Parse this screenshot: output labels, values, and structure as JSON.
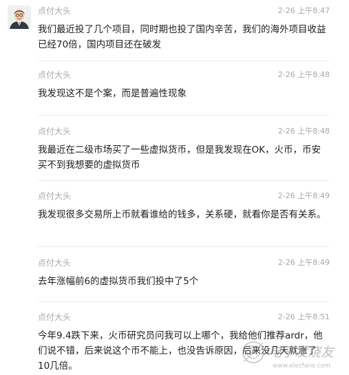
{
  "messages": [
    {
      "sender": "点付大头",
      "time": "2-26 上午8:47",
      "text": "我们最近投了几个项目，同时期也投了国内辛苦，我们的海外项目收益已经70倍，国内项目还在破发"
    },
    {
      "sender": "点付大头",
      "time": "2-26 上午8:48",
      "text": "我发现这不是个案，而是普遍性现象"
    },
    {
      "sender": "点付大头",
      "time": "2-26 上午8:48",
      "text": "我最近在二级市场买了一些虚拟货币，但是我发现在OK，火币，币安买不到我想要的虚拟货币"
    },
    {
      "sender": "点付大头",
      "time": "2-26 上午8:49",
      "text": "我发现很多交易所上币就看谁给的钱多，关系硬，就看你是否有关系。"
    },
    {
      "sender": "点付大头",
      "time": "2-26 上午8:49",
      "text": "去年涨幅前6的虚拟货币我们投中了5个"
    },
    {
      "sender": "点付大头",
      "time": "2-26 上午8:51",
      "text": "今年9.4跌下来，火币研究员问我可以上哪个，我给他们推荐ardr，他们说不错，后来说这个币不能上，也没告诉原因，后来没几天就涨了10几倍。"
    }
  ],
  "watermark": {
    "text": "电子发烧友",
    "url": "www.elecfans.com"
  },
  "colors": {
    "meta": "#a7a7a7",
    "text": "#1e1e1e",
    "divider": "#ececec"
  }
}
